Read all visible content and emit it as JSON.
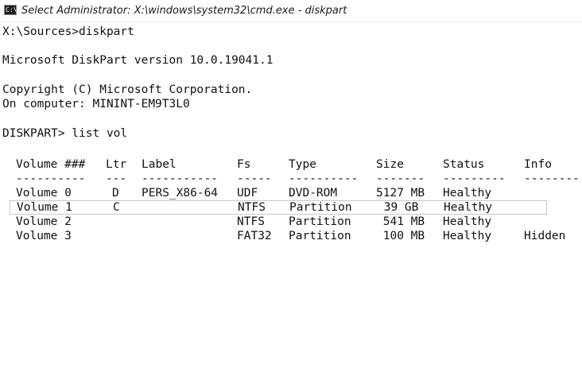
{
  "window": {
    "title": "Select Administrator: X:\\windows\\system32\\cmd.exe - diskpart",
    "icon_label": "C:\\"
  },
  "console": {
    "prompt_line": "X:\\Sources>diskpart",
    "version_line": "Microsoft DiskPart version 10.0.19041.1",
    "copyright_line": "Copyright (C) Microsoft Corporation.",
    "computer_line": "On computer: MININT-EM9T3L0",
    "command_line": "DISKPART> list vol"
  },
  "volume_table": {
    "headers": [
      "Volume ###",
      "Ltr",
      "Label",
      "Fs",
      "Type",
      "Size",
      "Status",
      "Info"
    ],
    "separators": [
      "----------",
      "---",
      "-----------",
      "-----",
      "----------",
      "-------",
      "---------",
      "--------"
    ],
    "rows": [
      [
        "Volume 0",
        "D",
        "PERS_X86-64",
        "UDF",
        "DVD-ROM",
        "5127 MB",
        "Healthy",
        ""
      ],
      [
        "Volume 1",
        "C",
        "",
        "NTFS",
        "Partition",
        " 39 GB",
        "Healthy",
        ""
      ],
      [
        "Volume 2",
        "",
        "",
        "NTFS",
        "Partition",
        " 541 MB",
        "Healthy",
        ""
      ],
      [
        "Volume 3",
        "",
        "",
        "FAT32",
        "Partition",
        " 100 MB",
        "Healthy",
        "Hidden"
      ]
    ],
    "selected_row": "Volume 1"
  },
  "colors": {
    "background": "#ffffff",
    "text": "#111111"
  }
}
